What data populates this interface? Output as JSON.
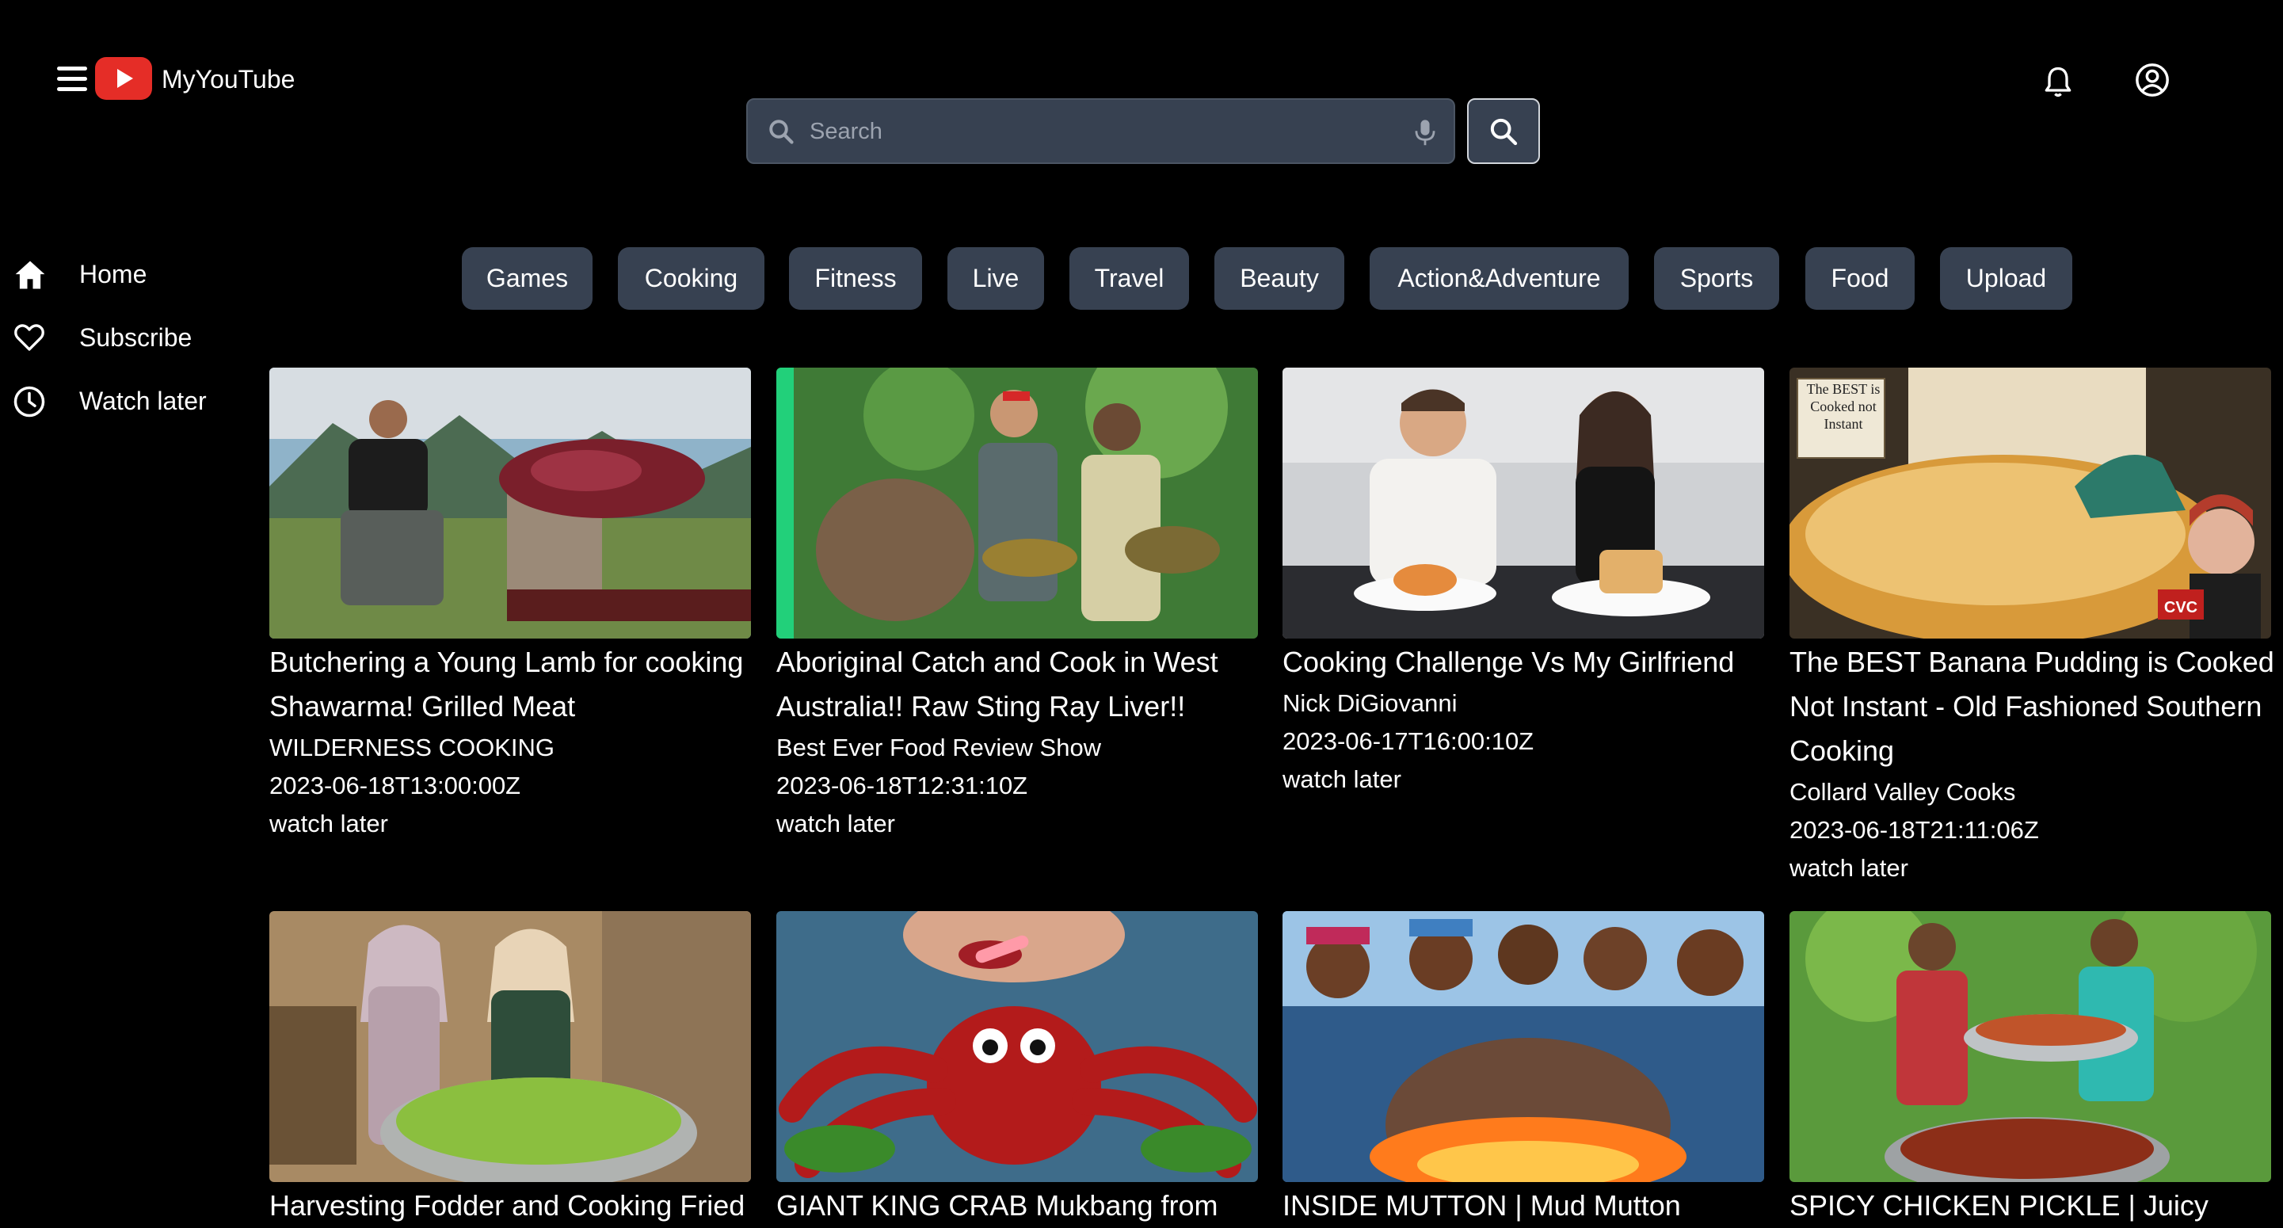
{
  "header": {
    "app_name": "MyYouTube",
    "search": {
      "placeholder": "Search",
      "value": ""
    }
  },
  "sidebar": {
    "items": [
      {
        "label": "Home",
        "icon": "home-icon"
      },
      {
        "label": "Subscribe",
        "icon": "heart-icon"
      },
      {
        "label": "Watch later",
        "icon": "clock-icon"
      }
    ]
  },
  "categories": [
    "Games",
    "Cooking",
    "Fitness",
    "Live",
    "Travel",
    "Beauty",
    "Action&Adventure",
    "Sports",
    "Food",
    "Upload"
  ],
  "videos": [
    {
      "title": "Butchering a Young Lamb for cooking Shawarma! Grilled Meat",
      "channel": "WILDERNESS COOKING",
      "published": "2023-06-18T13:00:00Z",
      "action": "watch later"
    },
    {
      "title": "Aboriginal Catch and Cook in West Australia!! Raw Sting Ray Liver!!",
      "channel": "Best Ever Food Review Show",
      "published": "2023-06-18T12:31:10Z",
      "action": "watch later"
    },
    {
      "title": "Cooking Challenge Vs My Girlfriend",
      "channel": "Nick DiGiovanni",
      "published": "2023-06-17T16:00:10Z",
      "action": "watch later"
    },
    {
      "title": "The BEST Banana Pudding is Cooked Not Instant - Old Fashioned Southern Cooking",
      "channel": "Collard Valley Cooks",
      "published": "2023-06-18T21:11:06Z",
      "action": "watch later",
      "thumb_text": "The BEST is Cooked not Instant",
      "thumb_badge": "CVC"
    },
    {
      "title": "Harvesting Fodder and Cooking Fried",
      "channel": "",
      "published": "",
      "action": ""
    },
    {
      "title": "GIANT KING CRAB Mukbang from",
      "channel": "",
      "published": "",
      "action": ""
    },
    {
      "title": "INSIDE MUTTON | Mud Mutton",
      "channel": "",
      "published": "",
      "action": ""
    },
    {
      "title": "SPICY CHICKEN PICKLE | Juicy",
      "channel": "",
      "published": "",
      "action": ""
    }
  ],
  "colors": {
    "background": "#000000",
    "chip": "#374151",
    "logo": "#e52d27",
    "text": "#ffffff"
  }
}
